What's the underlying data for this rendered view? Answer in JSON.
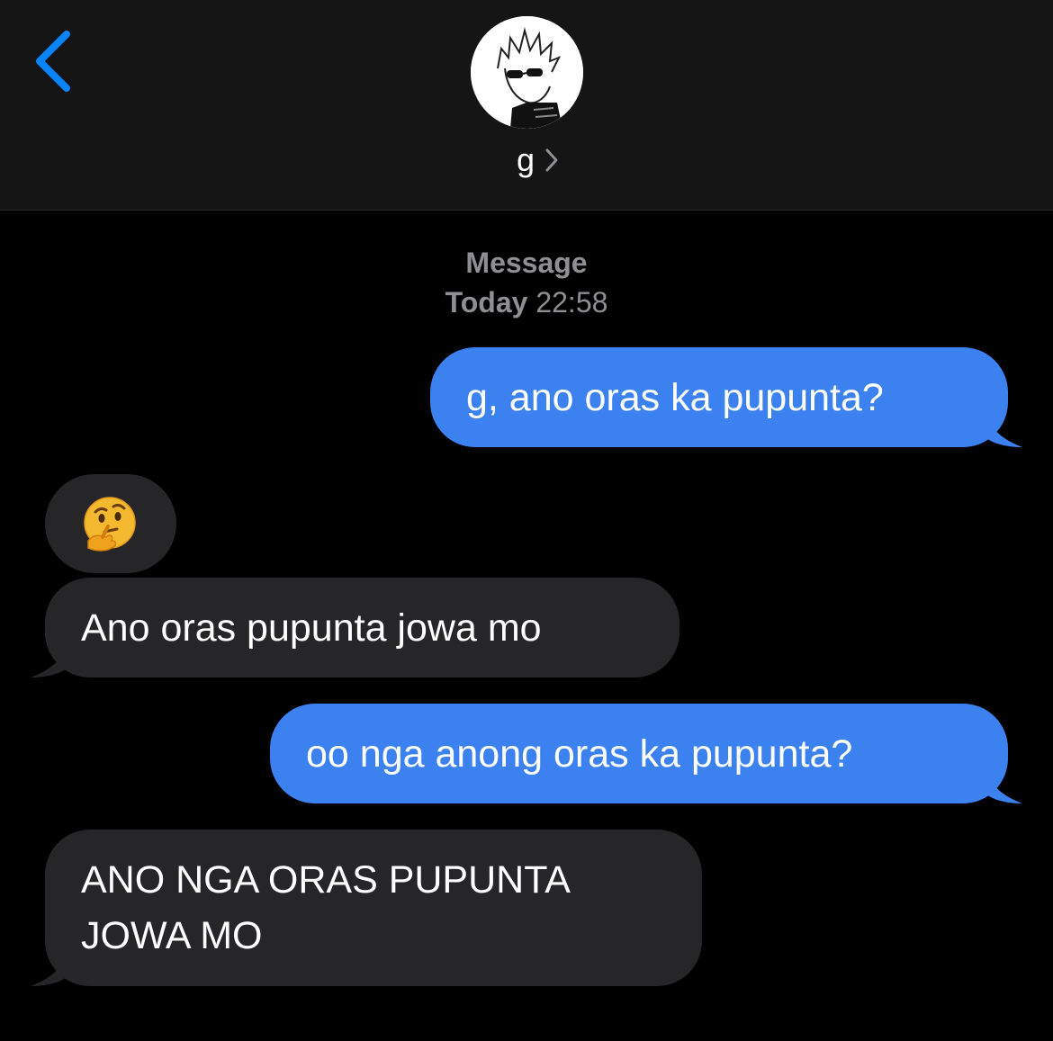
{
  "header": {
    "contact_name": "g",
    "back_icon": "chevron-left-icon",
    "chevron_icon": "chevron-right-icon",
    "accent_color": "#0a84ff"
  },
  "thread": {
    "timestamp_label": "Message",
    "timestamp_day": "Today",
    "timestamp_time": "22:58"
  },
  "messages": [
    {
      "direction": "sent",
      "text": "g, ano oras ka pupunta?"
    },
    {
      "direction": "received",
      "text": "",
      "emoji_icon": "thinking-face-icon"
    },
    {
      "direction": "received",
      "text": "Ano oras pupunta jowa mo"
    },
    {
      "direction": "sent",
      "text": "oo nga anong oras ka pupunta?"
    },
    {
      "direction": "received",
      "text_line1": "ANO NGA ORAS PUPUNTA",
      "text_line2": "JOWA MO"
    }
  ],
  "colors": {
    "sent_bubble": "#3b82f0",
    "received_bubble": "#262628",
    "header_bg": "#151515",
    "timestamp_text": "#8e8e93"
  }
}
